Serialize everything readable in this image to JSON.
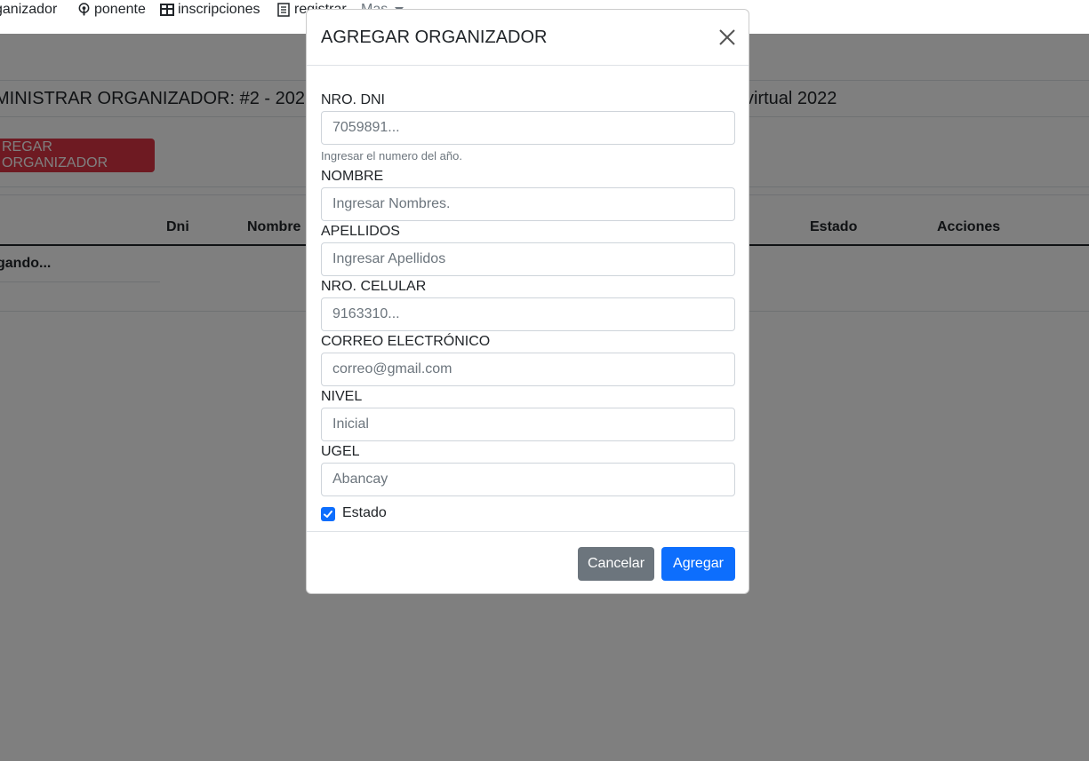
{
  "nav": {
    "items": [
      {
        "label": "ganizador",
        "icon": "user-icon"
      },
      {
        "label": "ponente",
        "icon": "podcast-icon"
      },
      {
        "label": "inscripciones",
        "icon": "table-icon"
      },
      {
        "label": "registrar",
        "icon": "form-icon"
      }
    ],
    "more_label": "Mas"
  },
  "page": {
    "title_left": "MINISTRAR ORGANIZADOR: #2 - 2022",
    "title_right": "virtual 2022",
    "add_button": "REGAR ORGANIZADOR",
    "table_headers": {
      "dni": "Dni",
      "nombre": "Nombre",
      "estado": "Estado",
      "acciones": "Acciones"
    },
    "loading_text": "gando..."
  },
  "modal": {
    "title": "AGREGAR ORGANIZADOR",
    "fields": {
      "dni": {
        "label": "NRO. DNI",
        "placeholder": "7059891...",
        "help": "Ingresar el numero del año."
      },
      "nombre": {
        "label": "NOMBRE",
        "placeholder": "Ingresar Nombres."
      },
      "apellidos": {
        "label": "APELLIDOS",
        "placeholder": "Ingresar Apellidos"
      },
      "celular": {
        "label": "NRO. CELULAR",
        "placeholder": "9163310..."
      },
      "correo": {
        "label": "CORREO ELECTRÓNICO",
        "placeholder": "correo@gmail.com"
      },
      "nivel": {
        "label": "NIVEL",
        "placeholder": "Inicial"
      },
      "ugel": {
        "label": "UGEL",
        "placeholder": "Abancay"
      }
    },
    "estado_label": "Estado",
    "estado_checked": true,
    "cancel_label": "Cancelar",
    "submit_label": "Agregar"
  },
  "colors": {
    "primary": "#0d6efd",
    "secondary": "#6c757d",
    "danger": "#dc3545"
  }
}
